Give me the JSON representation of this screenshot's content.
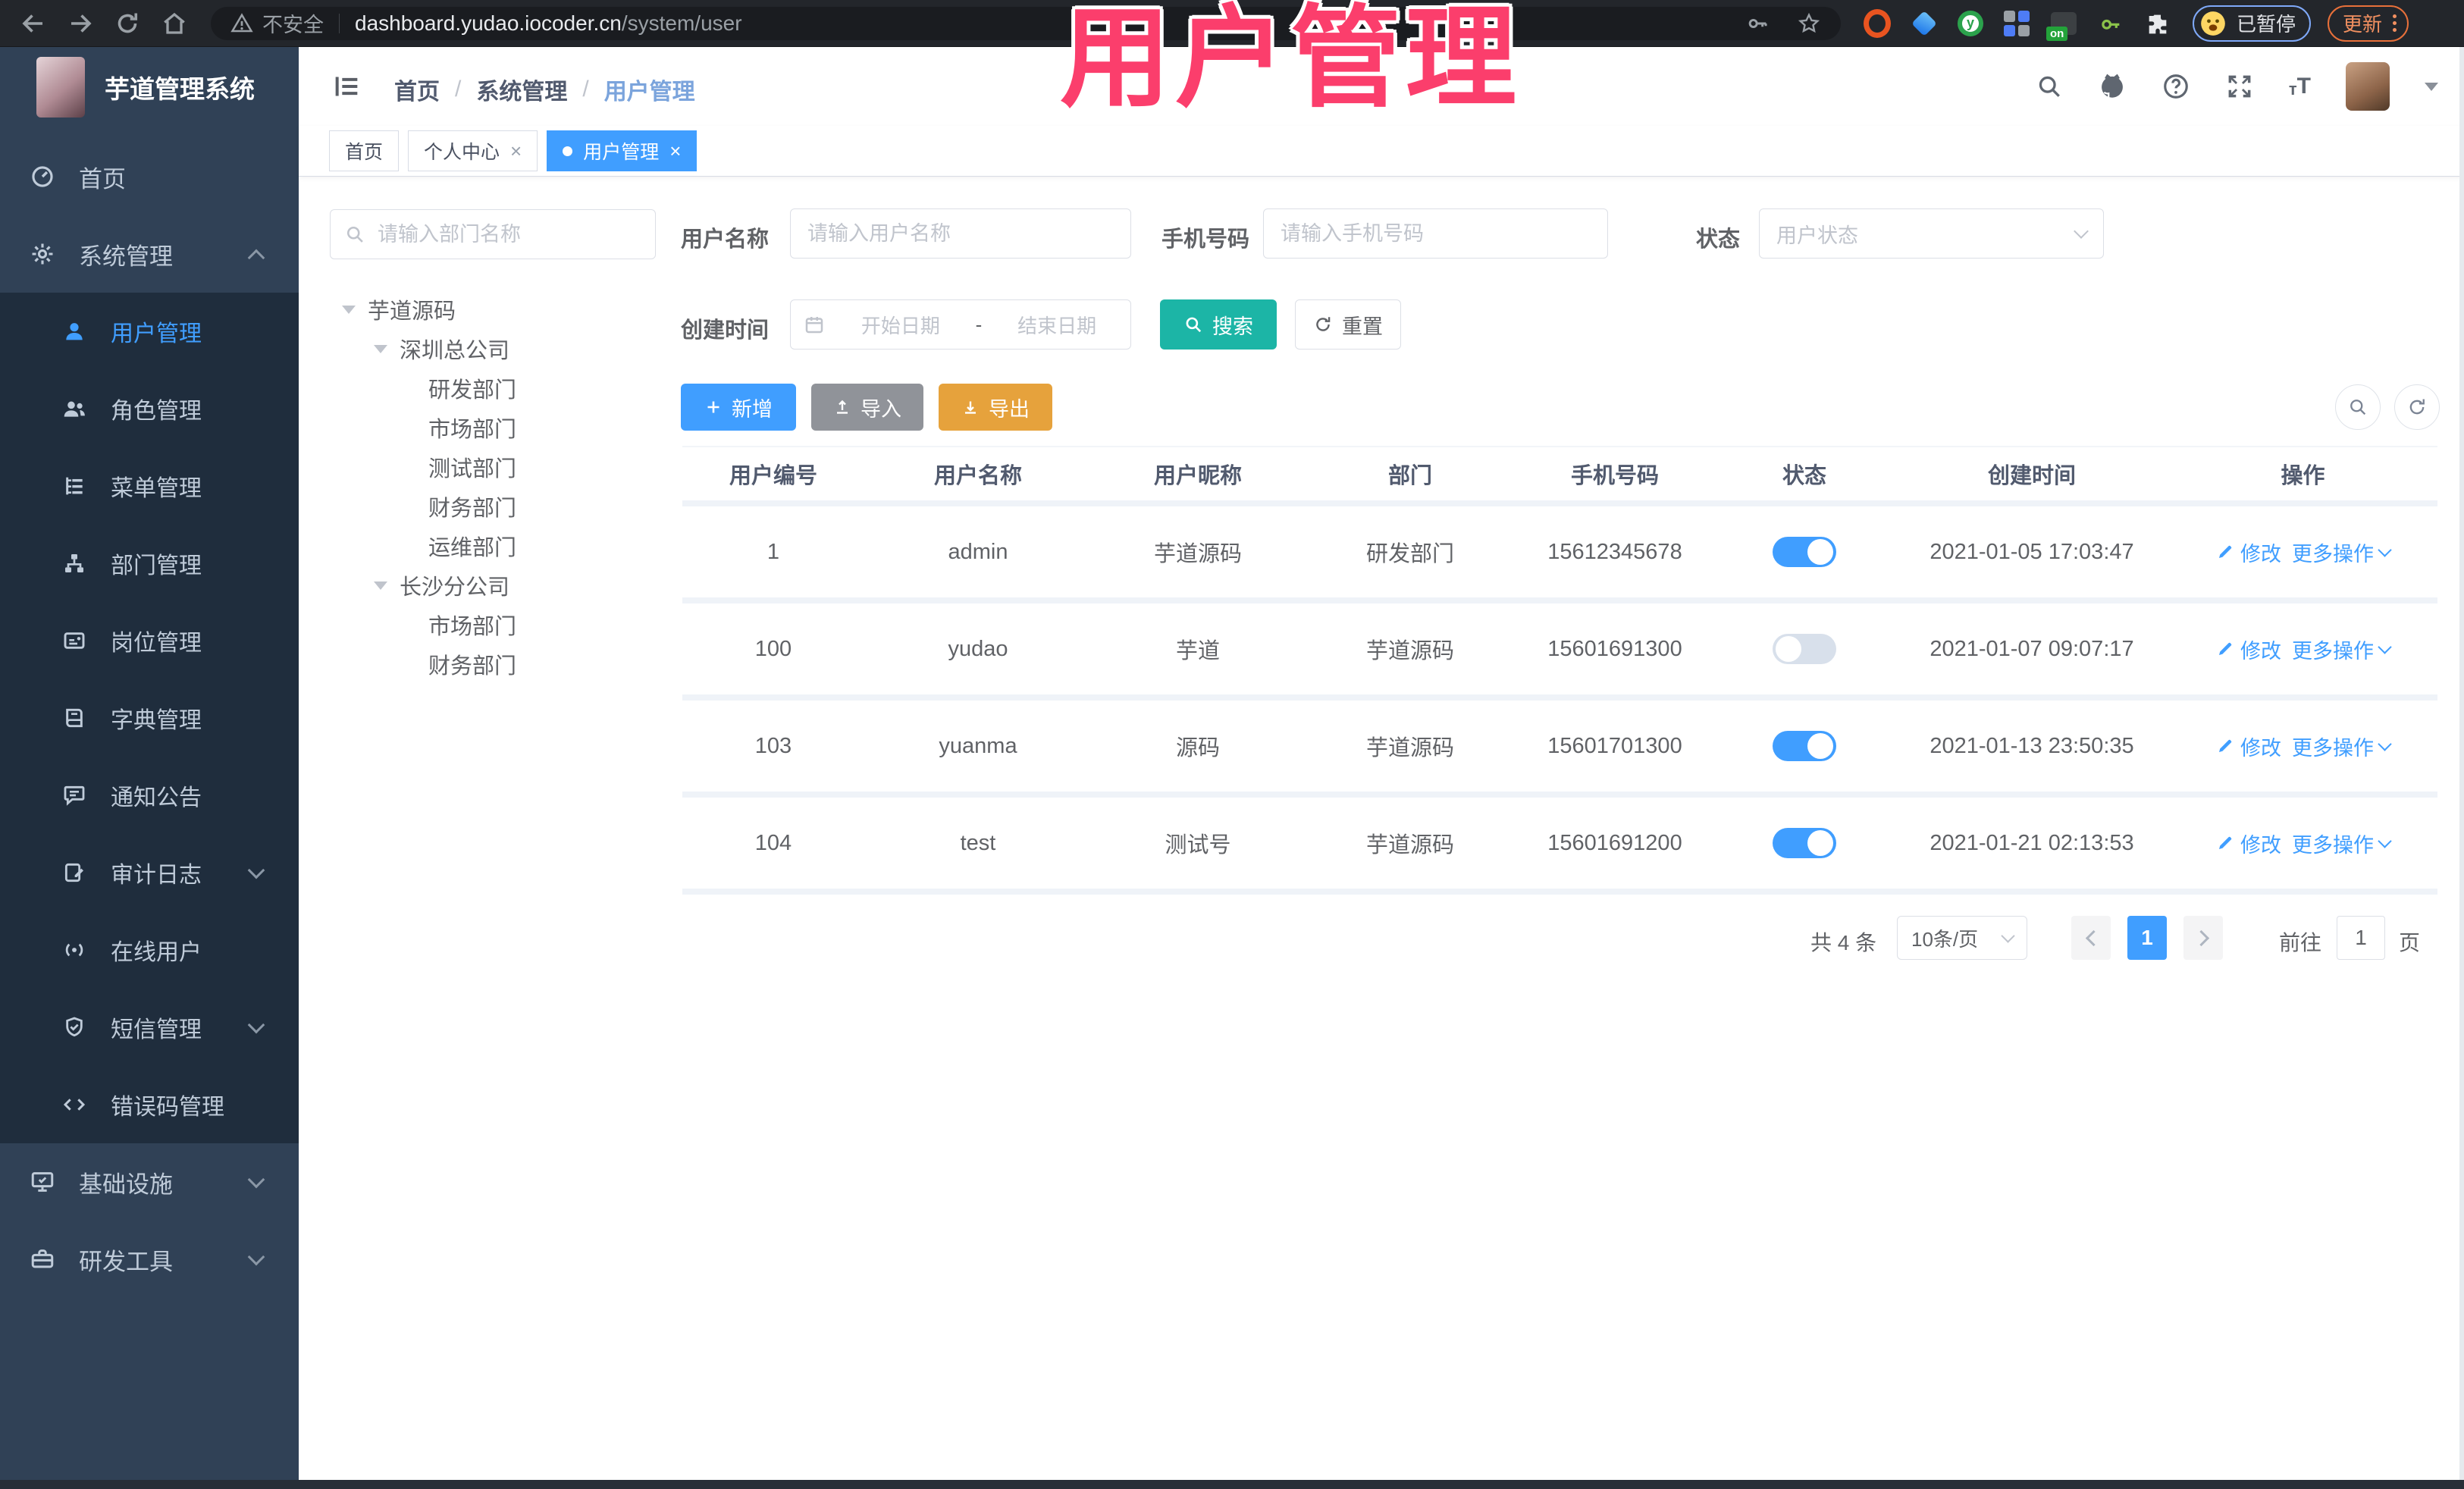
{
  "browser": {
    "security_label": "不安全",
    "url_host": "dashboard.yudao.iocoder.cn",
    "url_path": "/system/user",
    "extension_badge": "on",
    "profile_status": "已暂停",
    "update_label": "更新"
  },
  "overlay": {
    "title": "用户管理"
  },
  "app": {
    "logo_title": "芋道管理系统",
    "breadcrumb": {
      "items": [
        "首页",
        "系统管理",
        "用户管理"
      ],
      "separator": "/"
    },
    "tabs": [
      {
        "label": "首页"
      },
      {
        "label": "个人中心",
        "close": "×"
      },
      {
        "label": "用户管理",
        "close": "×"
      }
    ]
  },
  "sidebar": {
    "items": [
      {
        "label": "首页"
      },
      {
        "label": "系统管理"
      },
      {
        "label": "用户管理"
      },
      {
        "label": "角色管理"
      },
      {
        "label": "菜单管理"
      },
      {
        "label": "部门管理"
      },
      {
        "label": "岗位管理"
      },
      {
        "label": "字典管理"
      },
      {
        "label": "通知公告"
      },
      {
        "label": "审计日志"
      },
      {
        "label": "在线用户"
      },
      {
        "label": "短信管理"
      },
      {
        "label": "错误码管理"
      },
      {
        "label": "基础设施"
      },
      {
        "label": "研发工具"
      }
    ]
  },
  "tree": {
    "search_placeholder": "请输入部门名称",
    "nodes": [
      {
        "label": "芋道源码"
      },
      {
        "label": "深圳总公司"
      },
      {
        "label": "研发部门"
      },
      {
        "label": "市场部门"
      },
      {
        "label": "测试部门"
      },
      {
        "label": "财务部门"
      },
      {
        "label": "运维部门"
      },
      {
        "label": "长沙分公司"
      },
      {
        "label": "市场部门"
      },
      {
        "label": "财务部门"
      }
    ]
  },
  "filters": {
    "username_label": "用户名称",
    "username_placeholder": "请输入用户名称",
    "mobile_label": "手机号码",
    "mobile_placeholder": "请输入手机号码",
    "status_label": "状态",
    "status_placeholder": "用户状态",
    "create_time_label": "创建时间",
    "date_start_placeholder": "开始日期",
    "date_separator": "-",
    "date_end_placeholder": "结束日期",
    "search_button": "搜索",
    "reset_button": "重置"
  },
  "toolbar": {
    "add_label": "新增",
    "import_label": "导入",
    "export_label": "导出"
  },
  "table": {
    "headers": [
      "用户编号",
      "用户名称",
      "用户昵称",
      "部门",
      "手机号码",
      "状态",
      "创建时间",
      "操作"
    ],
    "action_edit": "修改",
    "action_more": "更多操作",
    "rows": [
      {
        "id": "1",
        "username": "admin",
        "nickname": "芋道源码",
        "dept": "研发部门",
        "mobile": "15612345678",
        "status": "on",
        "created": "2021-01-05 17:03:47"
      },
      {
        "id": "100",
        "username": "yudao",
        "nickname": "芋道",
        "dept": "芋道源码",
        "mobile": "15601691300",
        "status": "off",
        "created": "2021-01-07 09:07:17"
      },
      {
        "id": "103",
        "username": "yuanma",
        "nickname": "源码",
        "dept": "芋道源码",
        "mobile": "15601701300",
        "status": "on",
        "created": "2021-01-13 23:50:35"
      },
      {
        "id": "104",
        "username": "test",
        "nickname": "测试号",
        "dept": "芋道源码",
        "mobile": "15601691200",
        "status": "on",
        "created": "2021-01-21 02:13:53"
      }
    ]
  },
  "pagination": {
    "total": "共 4 条",
    "page_size": "10条/页",
    "current": "1",
    "goto_label": "前往",
    "goto_value": "1",
    "page_label": "页"
  },
  "colors": {
    "primary": "#409EFF",
    "search_teal": "#1CB5A6",
    "export_orange": "#E6A23C",
    "import_gray": "#909399",
    "sidebar_bg": "#304156",
    "submenu_bg": "#1F2D3D",
    "overlay_pink": "#FB3E6C"
  }
}
